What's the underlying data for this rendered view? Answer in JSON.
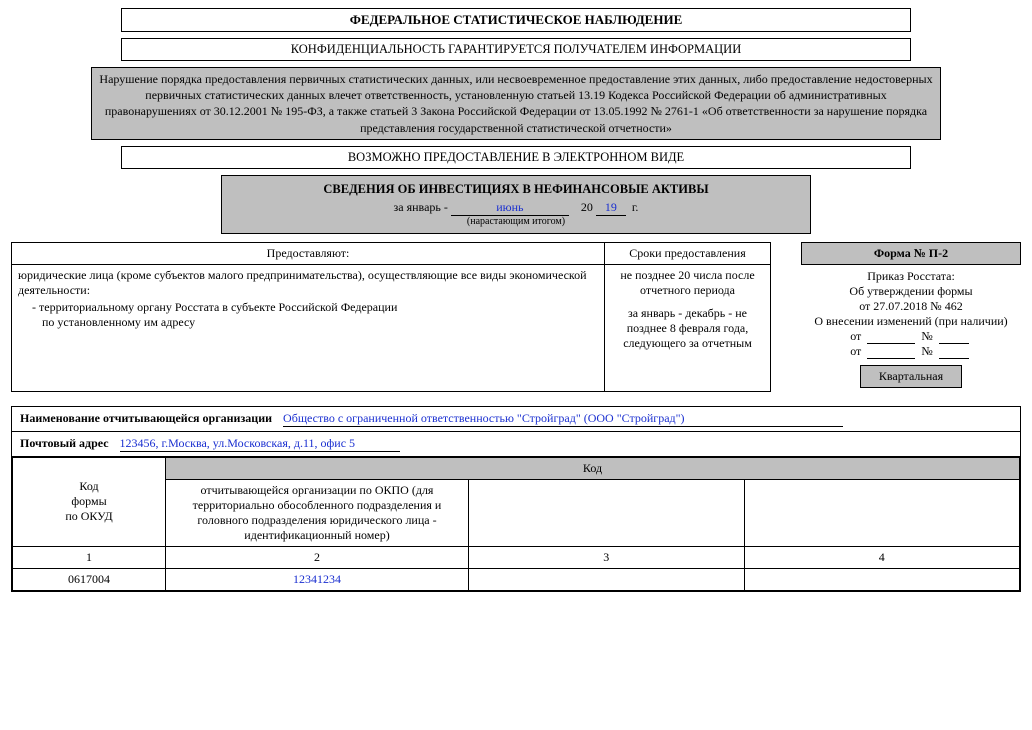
{
  "header": {
    "title": "ФЕДЕРАЛЬНОЕ СТАТИСТИЧЕСКОЕ НАБЛЮДЕНИЕ",
    "confidentiality": "КОНФИДЕНЦИАЛЬНОСТЬ ГАРАНТИРУЕТСЯ ПОЛУЧАТЕЛЕМ ИНФОРМАЦИИ",
    "notice": "Нарушение порядка предоставления первичных статистических данных, или несвоевременное предоставление этих данных, либо предоставление недостоверных первичных статистических данных влечет ответственность, установленную статьей 13.19 Кодекса Российской Федерации об административных правонарушениях от 30.12.2001 № 195-ФЗ, а также статьей 3 Закона Российской Федерации от 13.05.1992 № 2761-1 «Об ответственности за нарушение порядка представления государственной статистической отчетности»",
    "electronic": "ВОЗМОЖНО ПРЕДОСТАВЛЕНИЕ В ЭЛЕКТРОННОМ ВИДЕ"
  },
  "period": {
    "title": "СВЕДЕНИЯ ОБ ИНВЕСТИЦИЯХ В НЕФИНАНСОВЫЕ АКТИВЫ",
    "prefix": "за январь - ",
    "month": "июнь",
    "year_prefix": "20",
    "year_suffix": "19",
    "year_end": "г.",
    "note": "(нарастающим итогом)"
  },
  "provide": {
    "col1": "Предоставляют:",
    "col2": "Сроки предоставления",
    "who_line1": "юридические лица (кроме субъектов малого предпринимательства), осуществляющие все виды экономической деятельности:",
    "who_line2": "- территориальному органу Росстата в субъекте Российской Федерации",
    "who_line3": "по установленному им адресу",
    "deadline1": "не позднее 20 числа после отчетного периода",
    "deadline2": "за январь - декабрь - не позднее 8 февраля года, следующего за отчетным"
  },
  "right": {
    "form_label": "Форма № П-2",
    "order1": "Приказ Росстата:",
    "order2": "Об утверждении формы",
    "order3": "от 27.07.2018 № 462",
    "order4": "О внесении изменений (при наличии)",
    "ot": "от",
    "num": "№",
    "periodicity": "Квартальная"
  },
  "org": {
    "name_label": "Наименование отчитывающейся организации",
    "name_value": "Общество с ограниченной ответственностью \"Стройград\" (ООО \"Стройград\")",
    "addr_label": "Почтовый адрес",
    "addr_value": "123456, г.Москва, ул.Московская, д.11, офис 5"
  },
  "codes": {
    "code_header": "Код",
    "col1_l1": "Код",
    "col1_l2": "формы",
    "col1_l3": "по ОКУД",
    "col2": "отчитывающейся организации по ОКПО (для территориально обособленного подразделения и головного подразделения юридического лица - идентификационный номер)",
    "n1": "1",
    "n2": "2",
    "n3": "3",
    "n4": "4",
    "v1": "0617004",
    "v2": "12341234"
  }
}
